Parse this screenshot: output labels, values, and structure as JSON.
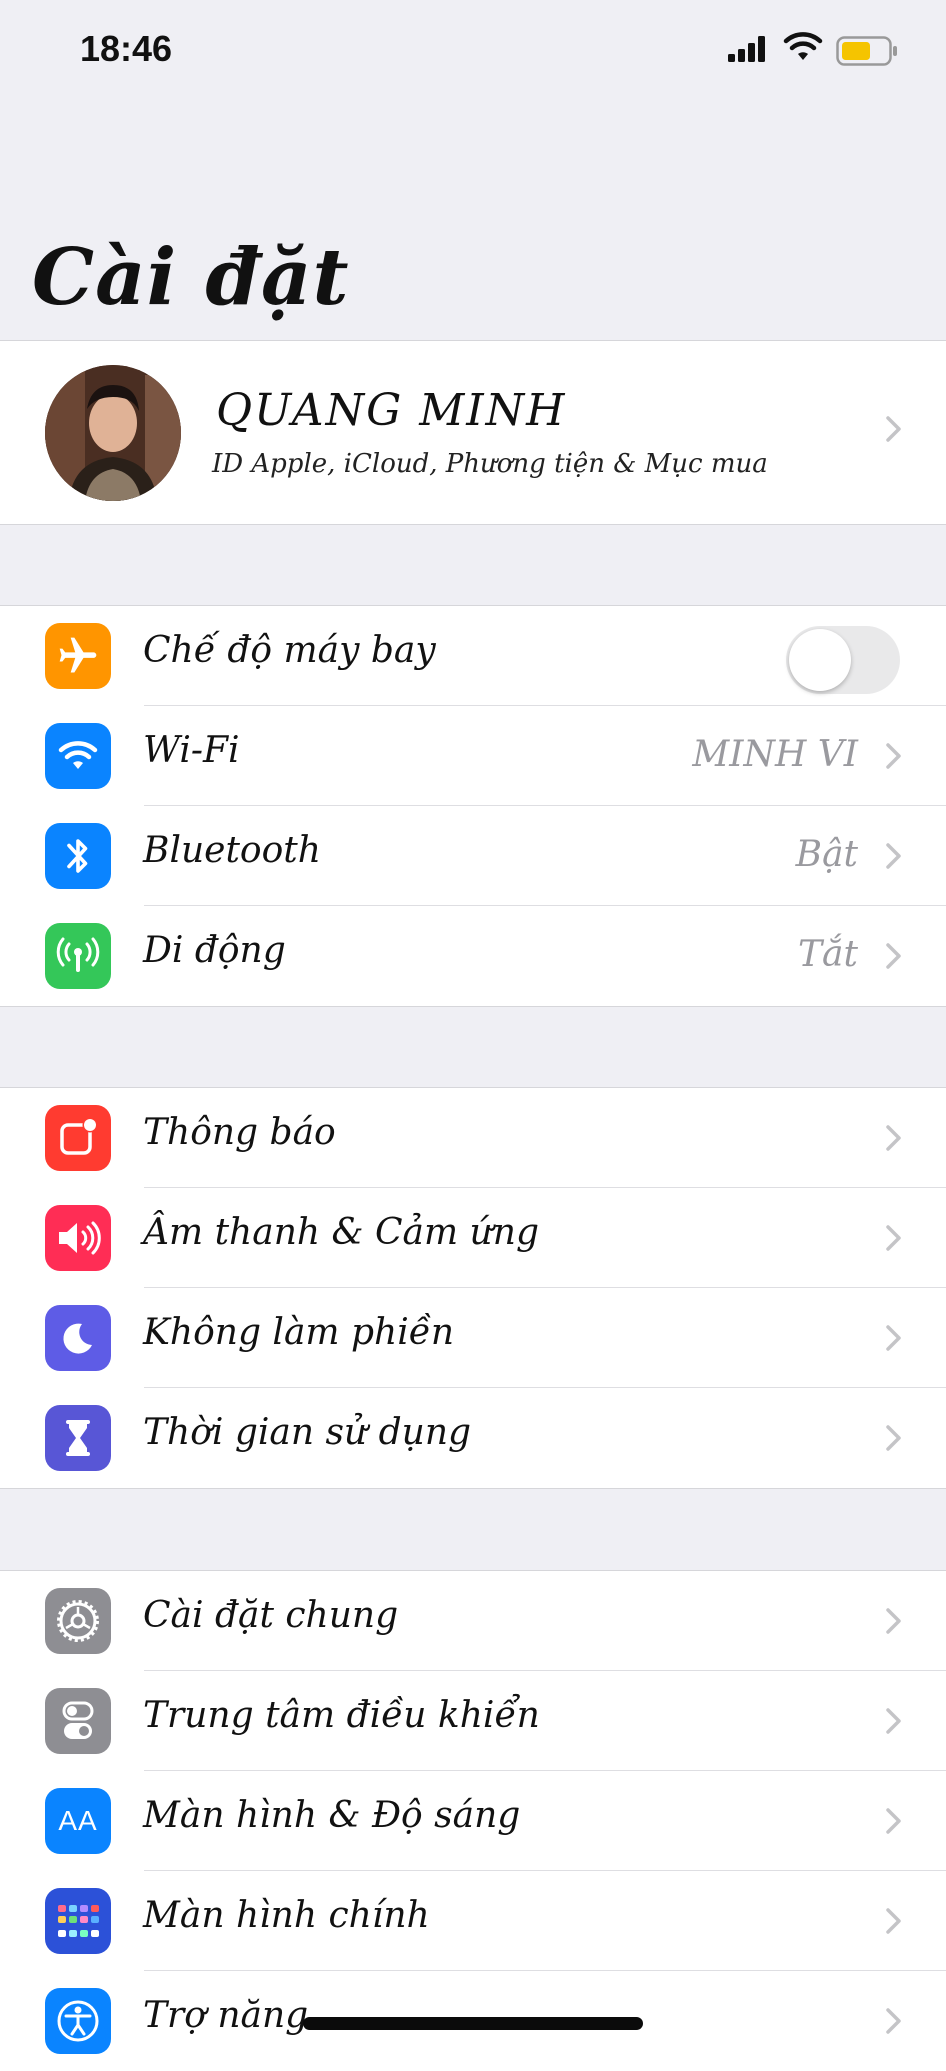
{
  "status_bar": {
    "time": "18:46"
  },
  "page_title": "Cài đặt",
  "profile": {
    "name": "QUANG MINH",
    "subtitle": "ID Apple, iCloud, Phương tiện & Mục mua"
  },
  "group1": [
    {
      "label": "Chế độ máy bay",
      "icon": "airplane-icon",
      "color": "#ff9500",
      "control": "toggle",
      "on": false
    },
    {
      "label": "Wi-Fi",
      "value": "MINH VI",
      "icon": "wifi-icon",
      "color": "#0a84ff"
    },
    {
      "label": "Bluetooth",
      "value": "Bật",
      "icon": "bluetooth-icon",
      "color": "#0a84ff"
    },
    {
      "label": "Di động",
      "value": "Tắt",
      "icon": "cellular-icon",
      "color": "#34c759"
    }
  ],
  "group2": [
    {
      "label": "Thông báo",
      "icon": "notifications-icon",
      "color": "#ff3b30"
    },
    {
      "label": "Âm thanh & Cảm ứng",
      "icon": "sound-icon",
      "color": "#ff2d55"
    },
    {
      "label": "Không làm phiền",
      "icon": "moon-icon",
      "color": "#5e5ce6"
    },
    {
      "label": "Thời gian sử dụng",
      "icon": "hourglass-icon",
      "color": "#5856d6"
    }
  ],
  "group3": [
    {
      "label": "Cài đặt chung",
      "icon": "gear-icon",
      "color": "#8e8e93"
    },
    {
      "label": "Trung tâm điều khiển",
      "icon": "control-center-icon",
      "color": "#8e8e93"
    },
    {
      "label": "Màn hình & Độ sáng",
      "icon": "display-icon",
      "color": "#0a84ff",
      "icon_text": "AA"
    },
    {
      "label": "Màn hình chính",
      "icon": "home-screen-icon",
      "color": "#2c51d8"
    },
    {
      "label": "Trợ năng",
      "icon": "accessibility-icon",
      "color": "#0a84ff"
    }
  ]
}
